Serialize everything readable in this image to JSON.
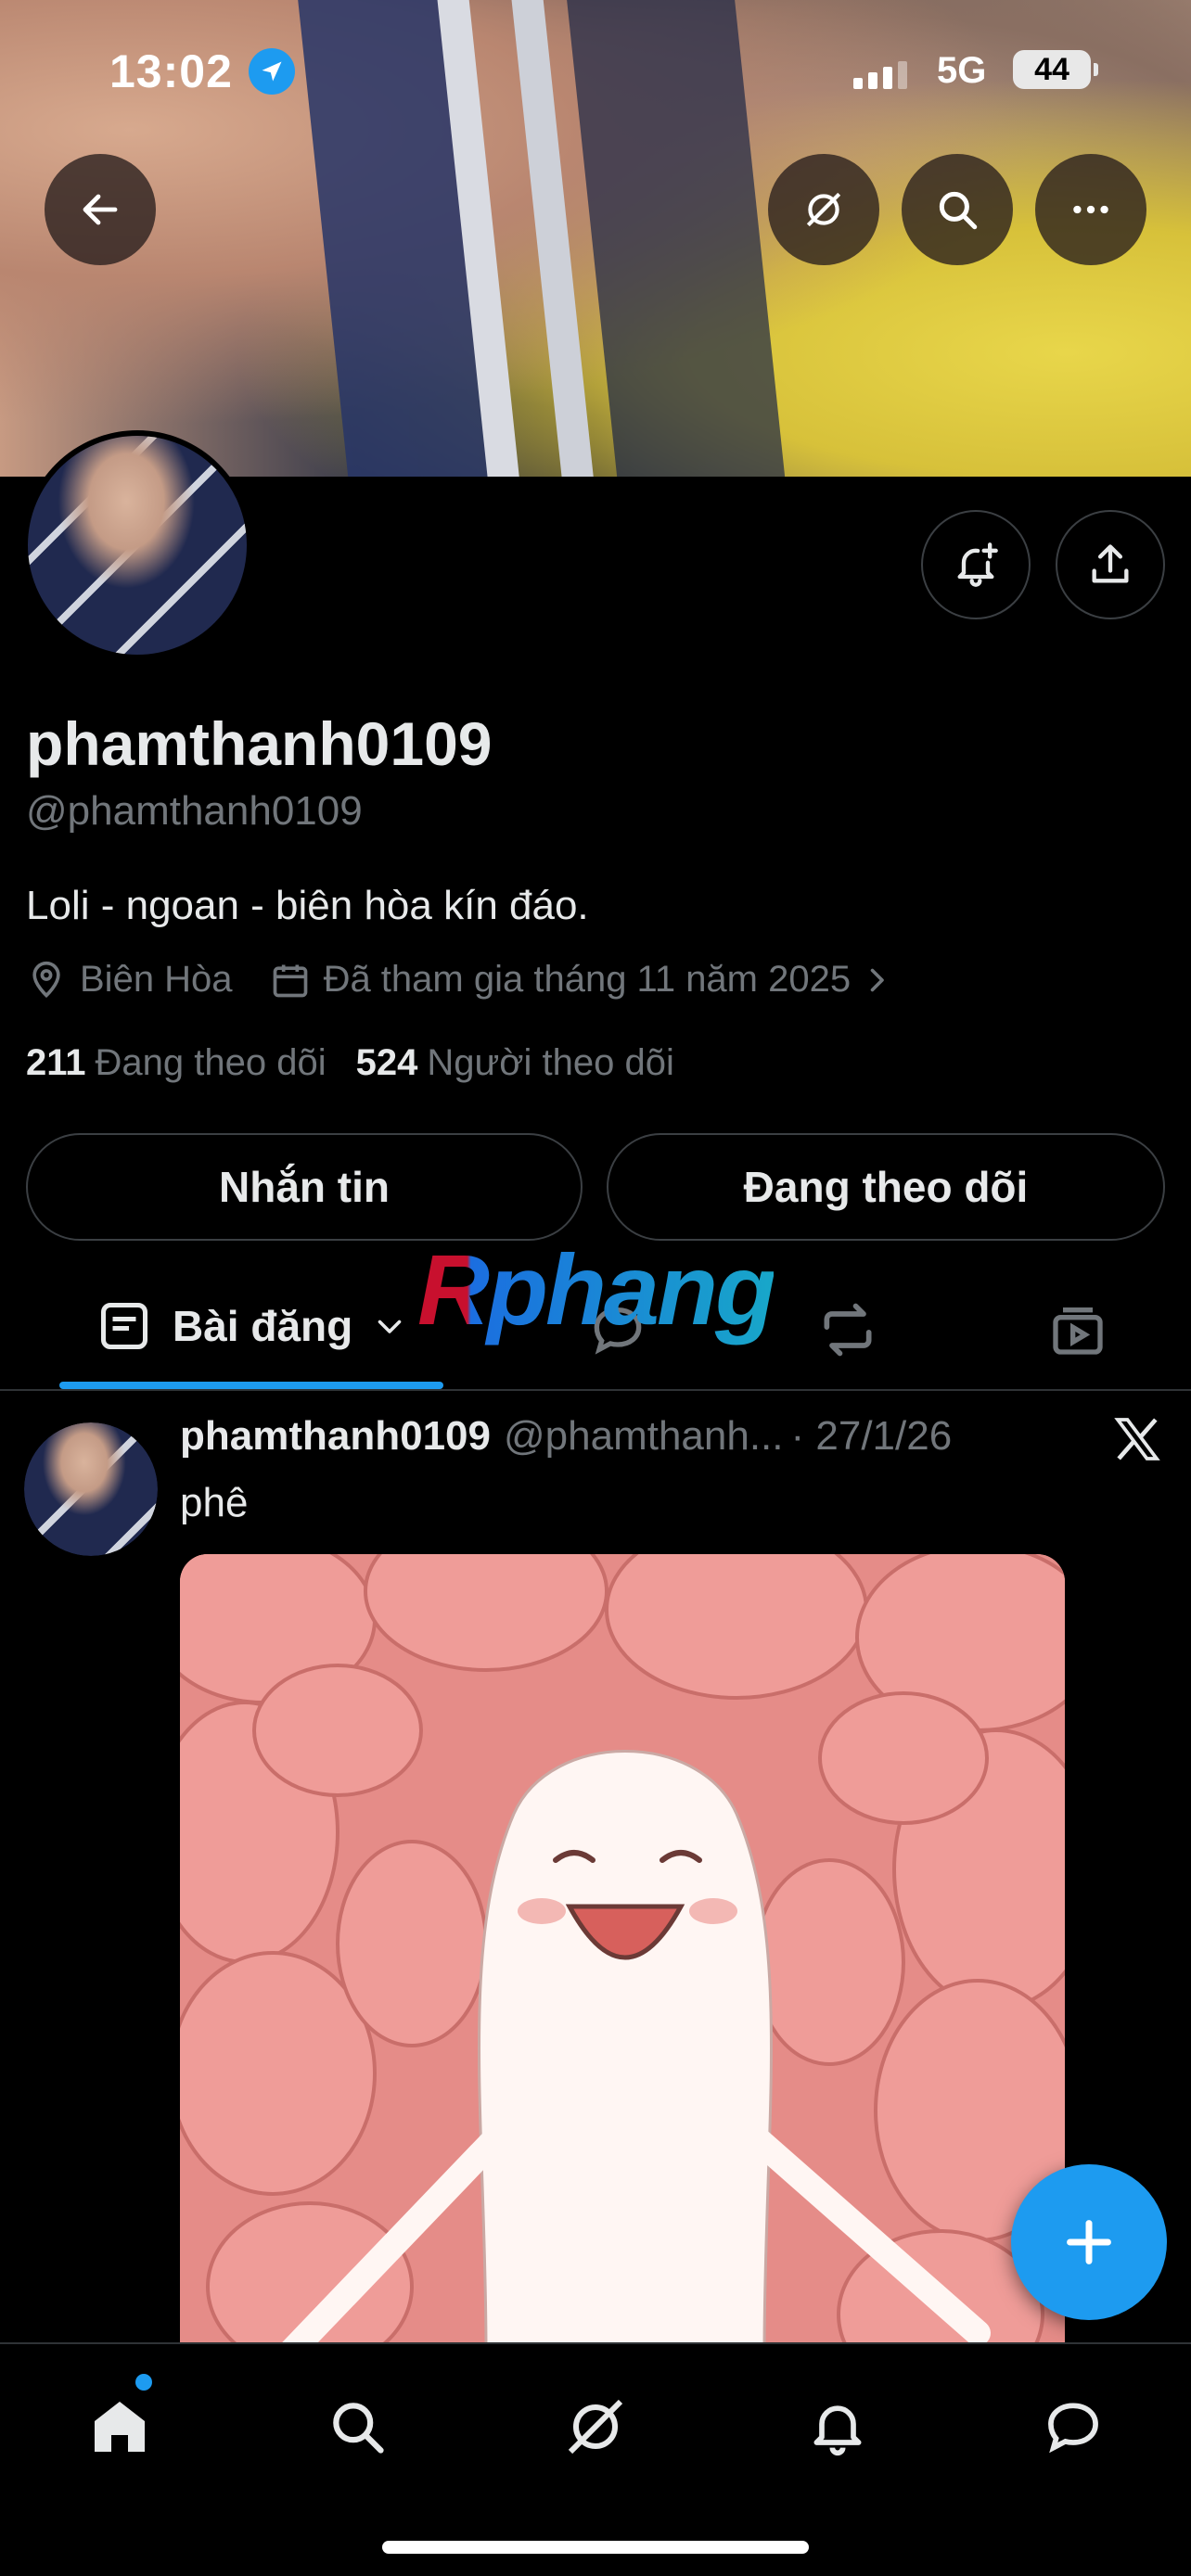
{
  "status_bar": {
    "time": "13:02",
    "network": "5G",
    "battery": "44"
  },
  "profile": {
    "display_name": "phamthanh0109",
    "handle": "@phamthanh0109",
    "bio": "Loli - ngoan - biên hòa kín đáo.",
    "location": "Biên Hòa",
    "joined": "Đã tham gia tháng 11 năm 2025",
    "following_count": "211",
    "following_label": "Đang theo dõi",
    "followers_count": "524",
    "followers_label": "Người theo dõi"
  },
  "actions": {
    "message_label": "Nhắn tin",
    "following_button_label": "Đang theo dõi"
  },
  "tabs": {
    "active_label": "Bài đăng"
  },
  "watermark": "Rphang",
  "post": {
    "author_name": "phamthanh0109",
    "author_handle": "@phamthanh...",
    "date": "· 27/1/26",
    "text": "phê"
  },
  "icons": {
    "banner": [
      "back-arrow-icon",
      "grok-icon",
      "search-icon",
      "more-icon"
    ],
    "profile": [
      "bell-plus-icon",
      "share-icon"
    ],
    "tabs": [
      "posts-icon",
      "chevron-down-icon",
      "reply-icon",
      "repost-icon",
      "media-icon"
    ],
    "nav": [
      "home-icon",
      "search-icon",
      "grok-icon",
      "bell-icon",
      "chat-icon"
    ]
  },
  "colors": {
    "accent": "#1d9bf0",
    "background": "#000000",
    "text": "#e7e9ea",
    "muted": "#71767b",
    "border": "#2f3336"
  }
}
